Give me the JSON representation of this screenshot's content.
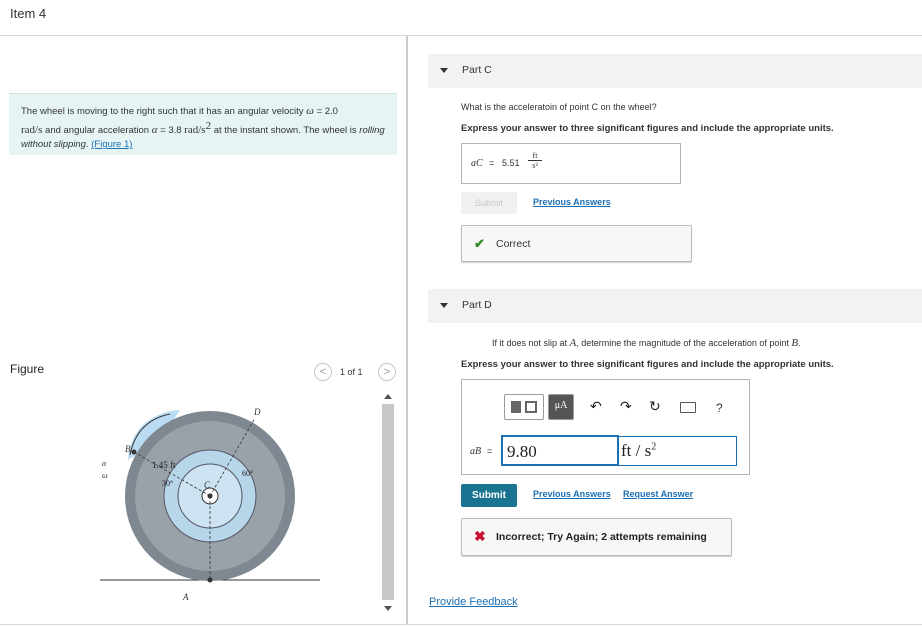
{
  "item_title": "Item 4",
  "problem": {
    "text_1": "The wheel is moving to the right such that it has an angular velocity ",
    "omega_sym": "ω",
    "text_2": " = 2.0",
    "unit_w": "rad/s",
    "text_3": " and angular acceleration ",
    "alpha_sym": "α",
    "text_4": " = 3.8 ",
    "unit_a": "rad/s",
    "unit_a_exp": "2",
    "text_5": " at the instant shown. The wheel is ",
    "rolling": "rolling without slipping",
    "text_6": ". ",
    "figure_link": "(Figure 1)"
  },
  "figure": {
    "title": "Figure",
    "pager": "1 of 1",
    "prev": "<",
    "next": ">",
    "labels": {
      "alpha": "α",
      "omega": "ω",
      "B": "B",
      "D": "D",
      "C": "C",
      "A": "A",
      "dist": "1.45 ft",
      "ang30": "30°",
      "ang60": "60°"
    }
  },
  "partC": {
    "label": "Part C",
    "question": "What is the acceleratoin of point C on the wheel?",
    "instruction": "Express your answer to three significant figures and include the appropriate units.",
    "var": "aC",
    "eq": "=",
    "value": "5.51",
    "unit_num": "ft",
    "unit_den": "s²",
    "submit": "Submit",
    "previous_answers": "Previous Answers",
    "feedback_mark": "✔",
    "feedback": "Correct"
  },
  "partD": {
    "label": "Part D",
    "question_1": "If it does not slip at ",
    "question_A": "A",
    "question_2": ", determine the magnitude of the acceleration of point ",
    "question_B": "B",
    "question_3": ".",
    "instruction": "Express your answer to three significant figures and include the appropriate units.",
    "toolbar": {
      "mu": "μA",
      "undo": "↶",
      "redo": "↷",
      "reset": "↻",
      "help": "?"
    },
    "var": "aB",
    "eq": "=",
    "value": "9.80",
    "units": "ft / s",
    "units_exp": "2",
    "submit": "Submit",
    "previous_answers": "Previous Answers",
    "request_answer": "Request Answer",
    "feedback_mark": "✖",
    "feedback": "Incorrect; Try Again; 2 attempts remaining"
  },
  "provide_feedback": "Provide Feedback",
  "colors": {
    "accent": "#1a6fb5",
    "submit_bg": "#1a7491",
    "correct": "#2e8b2e",
    "incorrect": "#c8102e",
    "problem_bg": "#e6f4f4"
  }
}
